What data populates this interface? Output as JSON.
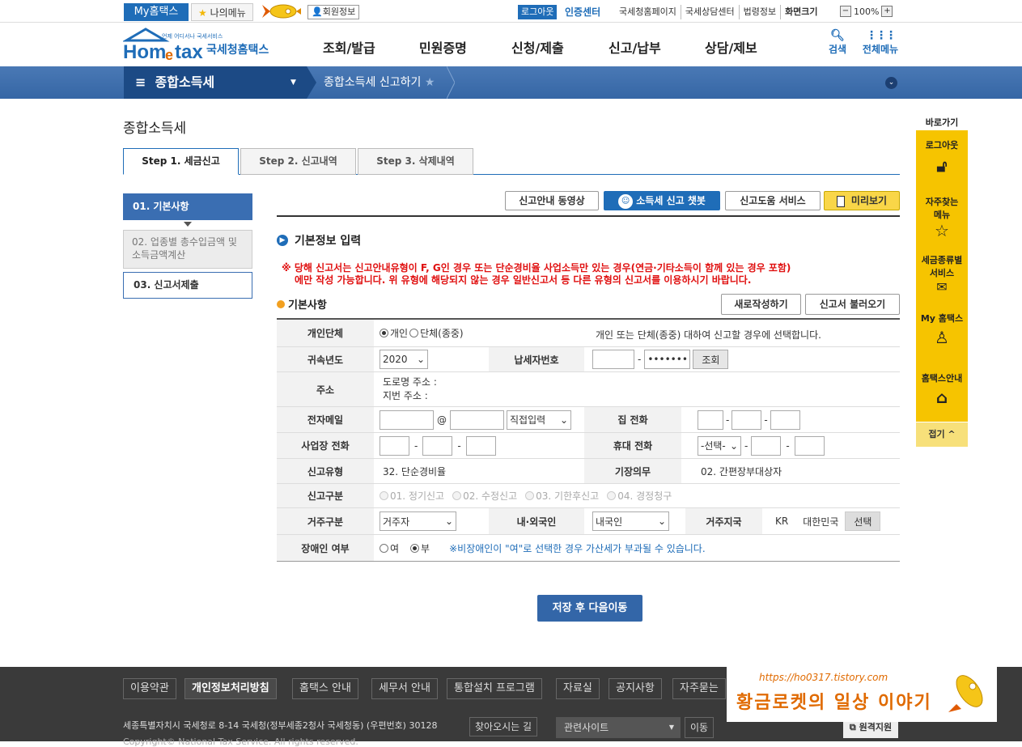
{
  "topbar": {
    "my_hometax": "My홈택스",
    "my_menu": "나의메뉴",
    "member_info": "회원정보",
    "logout": "로그아웃",
    "cert_center": "인증센터",
    "links": [
      "국세청홈페이지",
      "국세상담센터",
      "법령정보",
      "화면크기"
    ],
    "zoom": "100%"
  },
  "header": {
    "logo_small": "언제 어디서나 국세서비스",
    "logo_text": "국세청홈택스",
    "nav": [
      "조회/발급",
      "민원증명",
      "신청/제출",
      "신고/납부",
      "상담/제보"
    ],
    "search": "검색",
    "all_menu": "전체메뉴"
  },
  "crumb": {
    "menu": "종합소득세",
    "current": "종합소득세 신고하기"
  },
  "page": {
    "title": "종합소득세",
    "tabs": [
      "Step 1. 세금신고",
      "Step 2. 신고내역",
      "Step 3. 삭제내역"
    ],
    "side_nav": [
      "01. 기본사항",
      "02. 업종별 총수입금액 및 소득금액계산",
      "03. 신고서제출"
    ],
    "top_buttons": [
      "신고안내 동영상",
      "소득세 신고 챗봇",
      "신고도움 서비스",
      "미리보기"
    ],
    "section_title": "기본정보 입력",
    "notice_line1": "※ 당해 신고서는 신고안내유형이 F, G인 경우 또는 단순경비율 사업소득만 있는 경우(연금·기타소득이 함께 있는 경우 포함)",
    "notice_line2": "에만 작성 가능합니다. 위 유형에 해당되지 않는 경우 일반신고서 등 다른 유형의 신고서를 이용하시기 바랍니다.",
    "subtitle": "기본사항",
    "new_btn": "새로작성하기",
    "load_btn": "신고서 불러오기",
    "save_btn": "저장 후 다음이동"
  },
  "form": {
    "individual_label": "개인단체",
    "individual_opt1": "개인",
    "individual_opt2": "단체(종중)",
    "individual_help": "개인 또는 단체(종중) 대하여 신고할 경우에 선택합니다.",
    "year_label": "귀속년도",
    "year_value": "2020",
    "taxpayer_label": "납세자번호",
    "taxpayer_masked": "•••••••",
    "lookup_btn": "조회",
    "address_label": "주소",
    "road_addr": "도로명 주소 :",
    "lot_addr": "지번 주소 :",
    "email_label": "전자메일",
    "email_at": "@",
    "email_select": "직접입력",
    "home_phone_label": "집 전화",
    "biz_phone_label": "사업장 전화",
    "mobile_label": "휴대 전화",
    "mobile_select": "-선택-",
    "report_type_label": "신고유형",
    "report_type_value": "32. 단순경비율",
    "bookkeeping_label": "기장의무",
    "bookkeeping_value": "02. 간편장부대상자",
    "report_class_label": "신고구분",
    "report_class_opts": [
      "01. 정기신고",
      "02. 수정신고",
      "03. 기한후신고",
      "04. 경정청구"
    ],
    "residence_label": "거주구분",
    "residence_value": "거주자",
    "nationality_label": "내·외국인",
    "nationality_value": "내국인",
    "country_label": "거주지국",
    "country_code": "KR",
    "country_name": "대한민국",
    "country_btn": "선택",
    "disabled_label": "장애인 여부",
    "disabled_yes": "여",
    "disabled_no": "부",
    "disabled_help": "※비장애인이 \"여\"로 선택한 경우 가산세가 부과될 수 있습니다."
  },
  "quickbar": {
    "title": "바로가기",
    "items": [
      "로그아웃",
      "자주찾는 메뉴",
      "세금종류별 서비스",
      "My 홈택스",
      "홈택스안내"
    ],
    "close": "접기"
  },
  "footer": {
    "links": [
      "이용약관",
      "개인정보처리방침",
      "홈택스 안내",
      "세무서 안내",
      "통합설치 프로그램",
      "자료실",
      "공지사항",
      "자주묻는"
    ],
    "address": "세종특별자치시 국세청로 8-14 국세청(정부세종2청사 국세청동) (우편번호) 30128",
    "find_way": "찾아오시는 길",
    "copyright": "Copyright© National Tax Service. All rights reserved.",
    "related": "관련사이트",
    "go": "이동",
    "remote": "원격지원"
  },
  "watermark": {
    "url": "https://ho0317.tistory.com",
    "text": "황금로켓의 일상 이야기"
  }
}
